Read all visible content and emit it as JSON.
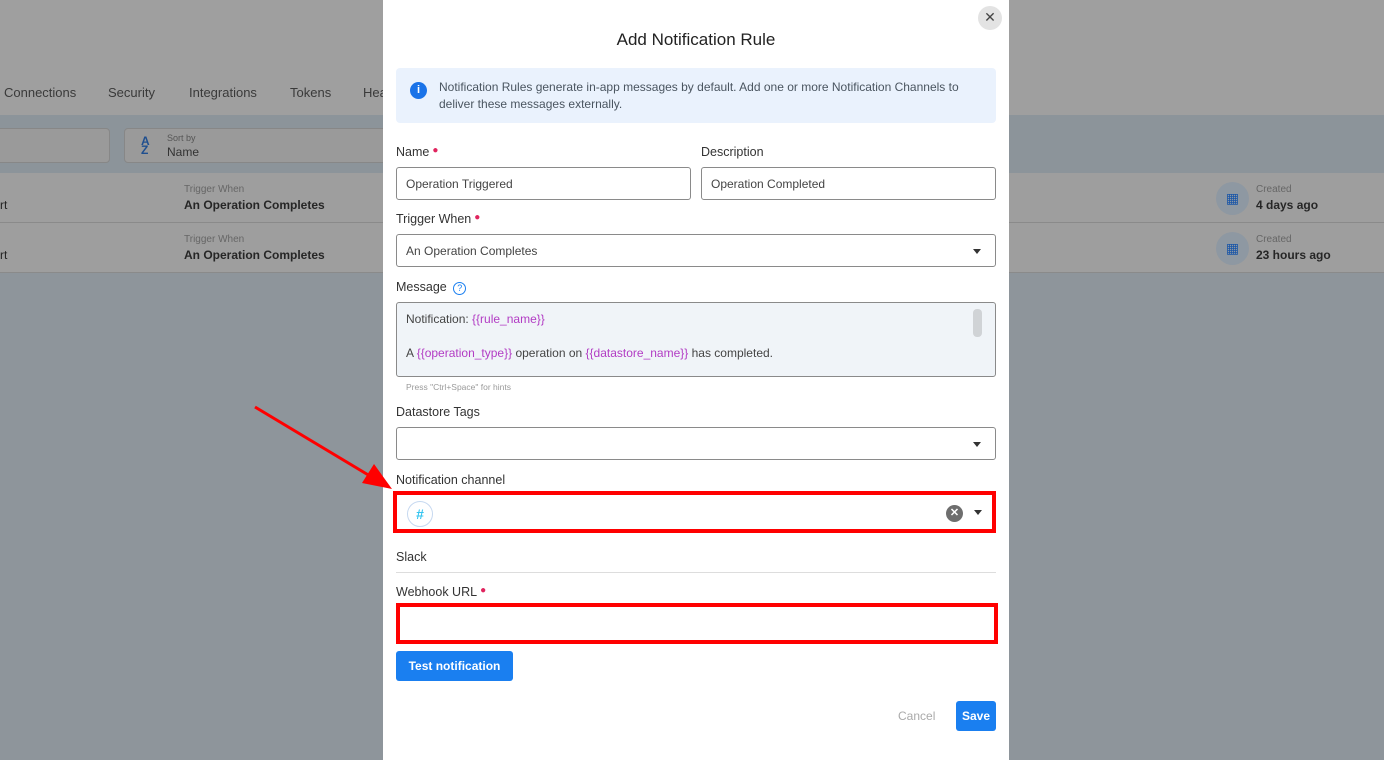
{
  "background": {
    "tabs": [
      "Connections",
      "Security",
      "Integrations",
      "Tokens",
      "Hea"
    ],
    "sort": {
      "label": "Sort by",
      "value": "Name"
    },
    "rows": [
      {
        "name_fragment": "rt",
        "trigger_label": "Trigger When",
        "trigger_value": "An Operation Completes",
        "created_label": "Created",
        "created_value": "4 days ago"
      },
      {
        "name_fragment": "rt",
        "trigger_label": "Trigger When",
        "trigger_value": "An Operation Completes",
        "created_label": "Created",
        "created_value": "23 hours ago"
      }
    ]
  },
  "modal": {
    "title": "Add Notification Rule",
    "close_icon": "close-icon",
    "info": "Notification Rules generate in-app messages by default. Add one or more Notification Channels to deliver these messages externally.",
    "name": {
      "label": "Name",
      "value": "Operation Triggered"
    },
    "description": {
      "label": "Description",
      "value": "Operation Completed"
    },
    "trigger": {
      "label": "Trigger When",
      "value": "An Operation Completes"
    },
    "message": {
      "label": "Message",
      "line1_prefix": "Notification: ",
      "line1_var": "{{rule_name}}",
      "line2_a": "A ",
      "line2_var1": "{{operation_type}}",
      "line2_b": " operation on ",
      "line2_var2": "{{datastore_name}}",
      "line2_c": " has completed.",
      "hint": "Press \"Ctrl+Space\" for hints"
    },
    "datastore_tags": {
      "label": "Datastore Tags",
      "value": ""
    },
    "notification_channel": {
      "label": "Notification channel",
      "selected_icon": "slack-icon"
    },
    "section": "Slack",
    "webhook": {
      "label": "Webhook URL",
      "value": ""
    },
    "test_button": "Test notification",
    "cancel_button": "Cancel",
    "save_button": "Save"
  },
  "colors": {
    "primary": "#1a7ff0",
    "highlight": "#ff0000",
    "variable": "#b23cc4",
    "required": "#e0245e"
  }
}
